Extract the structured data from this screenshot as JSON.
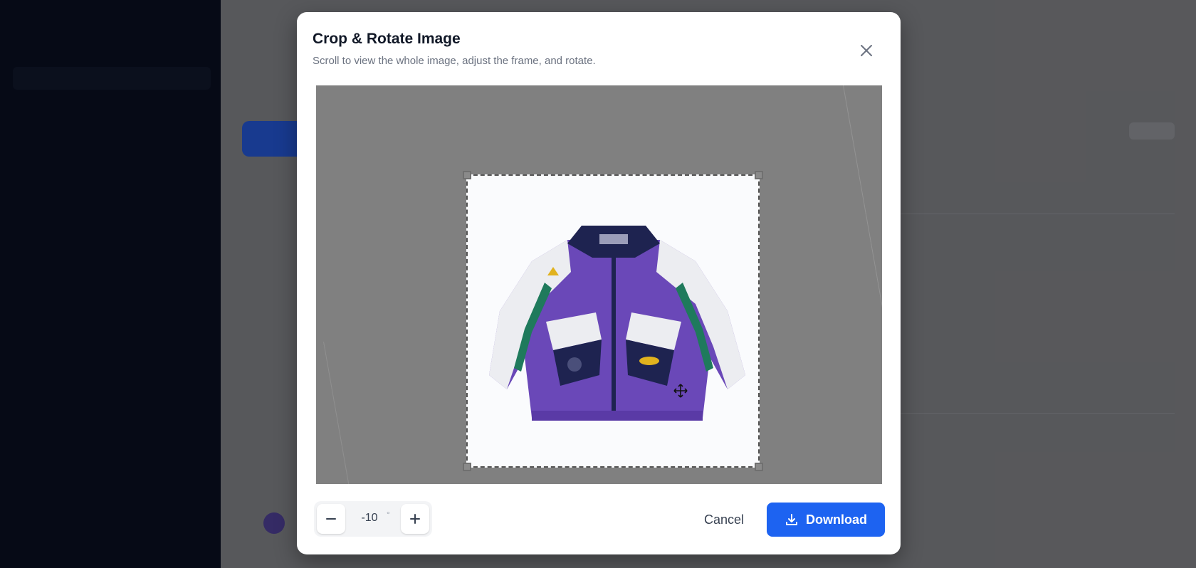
{
  "modal": {
    "title": "Crop & Rotate Image",
    "subtitle": "Scroll to view the whole image, adjust the frame, and rotate."
  },
  "rotation": {
    "value": "-10",
    "unit": "°"
  },
  "actions": {
    "cancel": "Cancel",
    "download": "Download"
  },
  "icons": {
    "close": "close-icon",
    "minus": "minus-icon",
    "plus": "plus-icon",
    "download": "download-icon",
    "move": "move-cursor-icon"
  },
  "colors": {
    "accent": "#1d63f1",
    "jacket_purple": "#6a48b8",
    "jacket_green": "#1f7a5c"
  }
}
